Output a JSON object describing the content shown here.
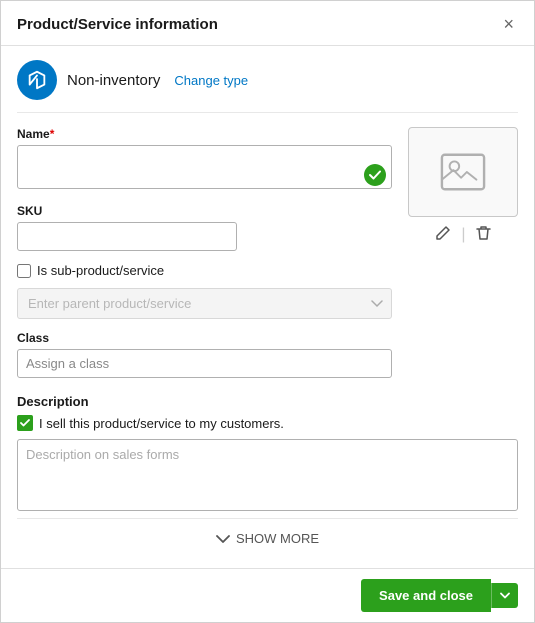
{
  "dialog": {
    "title": "Product/Service information",
    "close_label": "×"
  },
  "type": {
    "label": "Non-inventory",
    "change_link": "Change type"
  },
  "form": {
    "name_label": "Name",
    "name_required": "*",
    "name_placeholder": "",
    "sku_label": "SKU",
    "sku_placeholder": "",
    "sub_product_label": "Is sub-product/service",
    "parent_placeholder": "Enter parent product/service",
    "class_label": "Class",
    "class_placeholder": "Assign a class",
    "description_section_label": "Description",
    "sell_checkbox_label": "I sell this product/service to my customers.",
    "desc_placeholder": "Description on sales forms"
  },
  "show_more": {
    "label": "SHOW MORE"
  },
  "footer": {
    "save_close_label": "Save and close"
  },
  "icons": {
    "box": "box-icon",
    "image": "image-icon",
    "pencil": "pencil-icon",
    "trash": "trash-icon",
    "chevron_down": "chevron-down-icon",
    "check": "check-icon",
    "close": "close-icon"
  }
}
